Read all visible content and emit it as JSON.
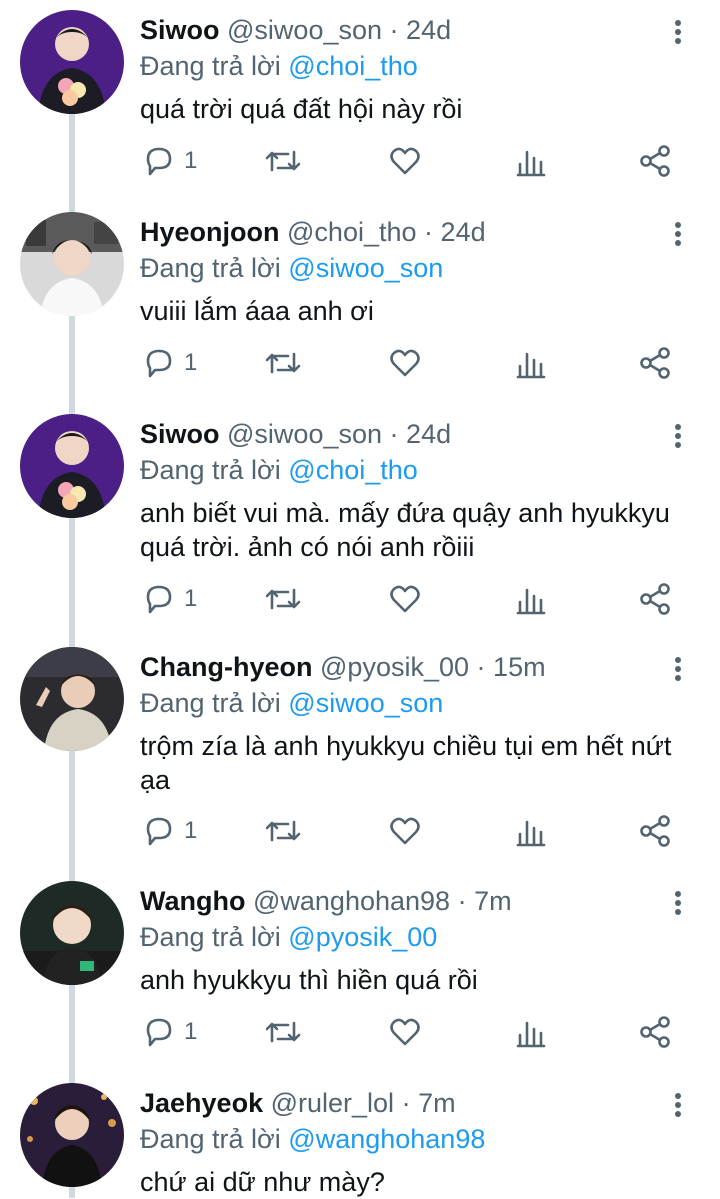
{
  "reply_prefix": "Đang trả lời",
  "separator": "·",
  "colors": {
    "link": "#1d9bf0",
    "secondary": "#536471",
    "text": "#0f1419",
    "thread_line": "#cfd9de"
  },
  "icons": [
    "reply-icon",
    "retweet-icon",
    "like-icon",
    "views-icon",
    "share-icon",
    "more-icon"
  ],
  "tweets": [
    {
      "name": "Siwoo",
      "handle": "@siwoo_son",
      "time": "24d",
      "reply_to": "@choi_tho",
      "text": "quá trời quá đất hội này rồi",
      "reply_count": "1"
    },
    {
      "name": "Hyeonjoon",
      "handle": "@choi_tho",
      "time": "24d",
      "reply_to": "@siwoo_son",
      "text": "vuiii lắm áaa anh ơi",
      "reply_count": "1"
    },
    {
      "name": "Siwoo",
      "handle": "@siwoo_son",
      "time": "24d",
      "reply_to": "@choi_tho",
      "text": "anh biết vui mà. mấy đứa quậy anh hyukkyu quá trời. ảnh có nói anh rồiii",
      "reply_count": "1"
    },
    {
      "name": "Chang-hyeon",
      "handle": "@pyosik_00",
      "time": "15m",
      "reply_to": "@siwoo_son",
      "text": "trộm zía là anh hyukkyu chiều tụi em hết nứt ạa",
      "reply_count": "1"
    },
    {
      "name": "Wangho",
      "handle": "@wanghohan98",
      "time": "7m",
      "reply_to": "@pyosik_00",
      "text": "anh hyukkyu thì hiền quá rồi",
      "reply_count": "1"
    },
    {
      "name": "Jaehyeok",
      "handle": "@ruler_lol",
      "time": "7m",
      "reply_to": "@wanghohan98",
      "text": "chứ ai dữ như mày?",
      "reply_count": ""
    }
  ]
}
